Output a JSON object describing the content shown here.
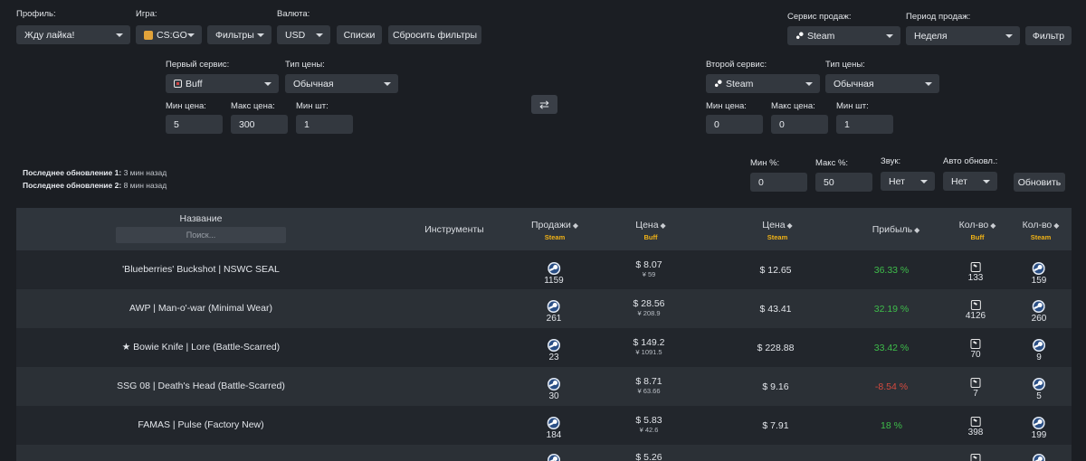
{
  "labels": {
    "profile": "Профиль:",
    "game": "Игра:",
    "currency": "Валюта:",
    "sales_service": "Сервис продаж:",
    "sales_period": "Период продаж:",
    "first_service": "Первый сервис:",
    "price_type_1": "Тип цены:",
    "second_service": "Второй сервис:",
    "price_type_2": "Тип цены:",
    "min_price_1": "Мин цена:",
    "max_price_1": "Макс цена:",
    "min_qty_1": "Мин шт:",
    "min_price_2": "Мин цена:",
    "max_price_2": "Макс цена:",
    "min_qty_2": "Мин шт:",
    "min_pct": "Мин %:",
    "max_pct": "Макс %:",
    "sound": "Звук:",
    "auto_refresh": "Авто обновл.:"
  },
  "controls": {
    "profile": "Жду лайка!",
    "game": "CS:GO",
    "filters": "Фильтры",
    "currency": "USD",
    "lists": "Списки",
    "reset_filters": "Сбросить фильтры",
    "sales_service": "Steam",
    "sales_period": "Неделя",
    "filter_button": "Фильтр",
    "first_service": "Buff",
    "price_type_1": "Обычная",
    "second_service": "Steam",
    "price_type_2": "Обычная",
    "min_price_1": "5",
    "max_price_1": "300",
    "min_qty_1": "1",
    "min_price_2": "0",
    "max_price_2": "0",
    "min_qty_2": "1",
    "min_pct": "0",
    "max_pct": "50",
    "sound": "Нет",
    "auto_refresh": "Нет",
    "refresh_button": "Обновить",
    "swap_icon": "⇄"
  },
  "updates": {
    "u1_label": "Последнее обновление 1:",
    "u1_value": "3 мин назад",
    "u2_label": "Последнее обновление 2:",
    "u2_value": "8 мин назад"
  },
  "table": {
    "headers": {
      "name": "Название",
      "search_placeholder": "Поиск...",
      "tools": "Инструменты",
      "sales": "Продажи",
      "sales_sub": "Steam",
      "price_buff": "Цена",
      "price_buff_sub": "Buff",
      "price_steam": "Цена",
      "price_steam_sub": "Steam",
      "profit": "Прибыль",
      "qty_buff": "Кол-во",
      "qty_buff_sub": "Buff",
      "qty_steam": "Кол-во",
      "qty_steam_sub": "Steam",
      "sort_icon": "◆"
    },
    "rows": [
      {
        "name": "'Blueberries' Buckshot | NSWC SEAL",
        "sales": "1159",
        "buff_usd": "$ 8.07",
        "buff_cny": "¥ 59",
        "steam_price": "$ 12.65",
        "profit": "36.33 %",
        "buff_qty": "133",
        "steam_qty": "159"
      },
      {
        "name": "AWP | Man-o'-war (Minimal Wear)",
        "sales": "261",
        "buff_usd": "$ 28.56",
        "buff_cny": "¥ 208.9",
        "steam_price": "$ 43.41",
        "profit": "32.19 %",
        "buff_qty": "4126",
        "steam_qty": "260"
      },
      {
        "name": "★ Bowie Knife | Lore (Battle-Scarred)",
        "sales": "23",
        "buff_usd": "$ 149.2",
        "buff_cny": "¥ 1091.5",
        "steam_price": "$ 228.88",
        "profit": "33.42 %",
        "buff_qty": "70",
        "steam_qty": "9"
      },
      {
        "name": "SSG 08 | Death's Head (Battle-Scarred)",
        "sales": "30",
        "buff_usd": "$ 8.71",
        "buff_cny": "¥ 63.66",
        "steam_price": "$ 9.16",
        "profit": "-8.54 %",
        "buff_qty": "7",
        "steam_qty": "5"
      },
      {
        "name": "FAMAS | Pulse (Factory New)",
        "sales": "184",
        "buff_usd": "$ 5.83",
        "buff_cny": "¥ 42.6",
        "steam_price": "$ 7.91",
        "profit": "18 %",
        "buff_qty": "398",
        "steam_qty": "199"
      },
      {
        "name": "",
        "sales": "",
        "buff_usd": "$ 5.26",
        "buff_cny": "",
        "steam_price": "",
        "profit": "",
        "buff_qty": "",
        "steam_qty": ""
      }
    ]
  },
  "colors": {
    "background": "#1b1e23",
    "accent_gold": "#f0b216",
    "profit_positive": "#3ebd4a",
    "profit_negative": "#d54a3f"
  }
}
